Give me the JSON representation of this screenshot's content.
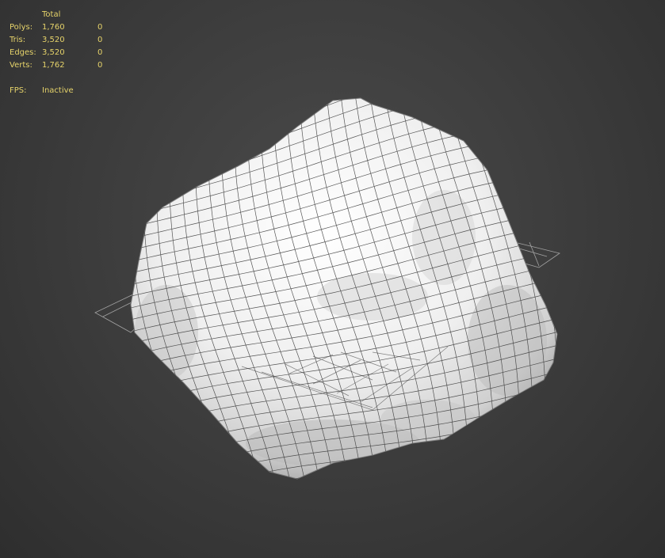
{
  "viewport": {
    "background_color": "#444444",
    "stat_text_color": "#e6d36a",
    "mesh_color": "#f2f2f2",
    "wire_color": "#3a3a3a",
    "grid_color": "#bdbdbd"
  },
  "stats": {
    "header": "Total",
    "rows": [
      {
        "label": "Polys:",
        "total": "1,760",
        "selected": "0"
      },
      {
        "label": "Tris:",
        "total": "3,520",
        "selected": "0"
      },
      {
        "label": "Edges:",
        "total": "3,520",
        "selected": "0"
      },
      {
        "label": "Verts:",
        "total": "1,762",
        "selected": "0"
      }
    ],
    "fps_label": "FPS:",
    "fps_value": "Inactive"
  }
}
